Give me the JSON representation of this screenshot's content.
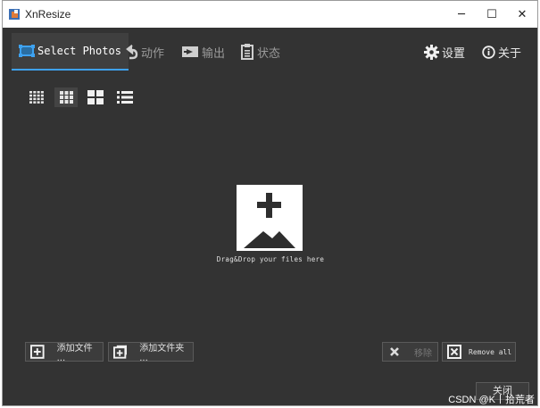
{
  "window": {
    "title": "XnResize",
    "controls": {
      "minimize": "─",
      "maximize": "☐",
      "close": "✕"
    }
  },
  "tabs": [
    {
      "label": "Select Photos",
      "icon": "select-photos-icon",
      "active": true
    },
    {
      "label": "动作",
      "icon": "action-icon",
      "active": false
    },
    {
      "label": "输出",
      "icon": "output-icon",
      "active": false
    },
    {
      "label": "状态",
      "icon": "status-icon",
      "active": false
    }
  ],
  "toolbar_right": [
    {
      "label": "设置",
      "icon": "gear-icon"
    },
    {
      "label": "关于",
      "icon": "info-icon"
    }
  ],
  "view_modes": [
    {
      "name": "small-grid",
      "selected": false
    },
    {
      "name": "medium-grid",
      "selected": true
    },
    {
      "name": "large-grid",
      "selected": false
    },
    {
      "name": "list",
      "selected": false
    }
  ],
  "dropzone": {
    "text": "Drag&Drop your files here"
  },
  "buttons": {
    "add_files": "添加文件 ...",
    "add_folder": "添加文件夹 ...",
    "remove": "移除",
    "remove_all": "Remove all",
    "close": "关闭"
  },
  "watermark": "CSDN @K丨拾荒者",
  "colors": {
    "accent": "#3ea2f0",
    "background": "#333333"
  }
}
